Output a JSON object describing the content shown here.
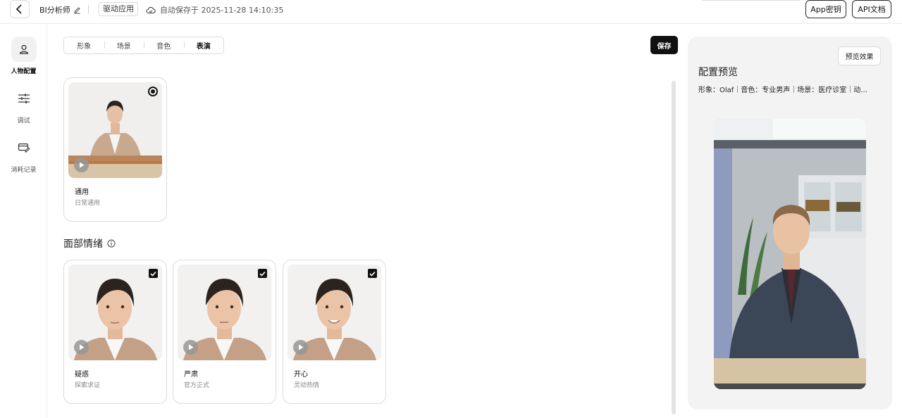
{
  "header": {
    "app_name": "BI分析师",
    "driver_tag": "驱动应用",
    "autosave": "自动保存于 2025-11-28 14:10:35",
    "app_key_label": "App密钥",
    "api_doc_label": "API文档"
  },
  "sidebar": {
    "items": [
      {
        "label": "人物配置",
        "icon": "person-icon",
        "active": true
      },
      {
        "label": "调试",
        "icon": "sliders-icon",
        "active": false
      },
      {
        "label": "消耗记录",
        "icon": "card-edit-icon",
        "active": false
      }
    ]
  },
  "tabs": [
    {
      "label": "形象",
      "active": false
    },
    {
      "label": "场景",
      "active": false
    },
    {
      "label": "音色",
      "active": false
    },
    {
      "label": "表演",
      "active": true
    }
  ],
  "save_label": "保存",
  "performance": {
    "selected": {
      "title": "通用",
      "subtitle": "日常通用"
    }
  },
  "facial_section": {
    "title": "面部情绪",
    "cards": [
      {
        "title": "疑惑",
        "subtitle": "探索求证",
        "checked": true
      },
      {
        "title": "严肃",
        "subtitle": "官方正式",
        "checked": true
      },
      {
        "title": "开心",
        "subtitle": "灵动热情",
        "checked": true
      }
    ]
  },
  "preview": {
    "button_label": "预览效果",
    "title": "配置预览",
    "summary": "形象：Olaf｜音色：专业男声｜场景：医疗诊室｜动..."
  },
  "colors": {
    "primary": "#111111",
    "panel_bg": "#f3f3f3",
    "border": "#dcdcdc"
  }
}
